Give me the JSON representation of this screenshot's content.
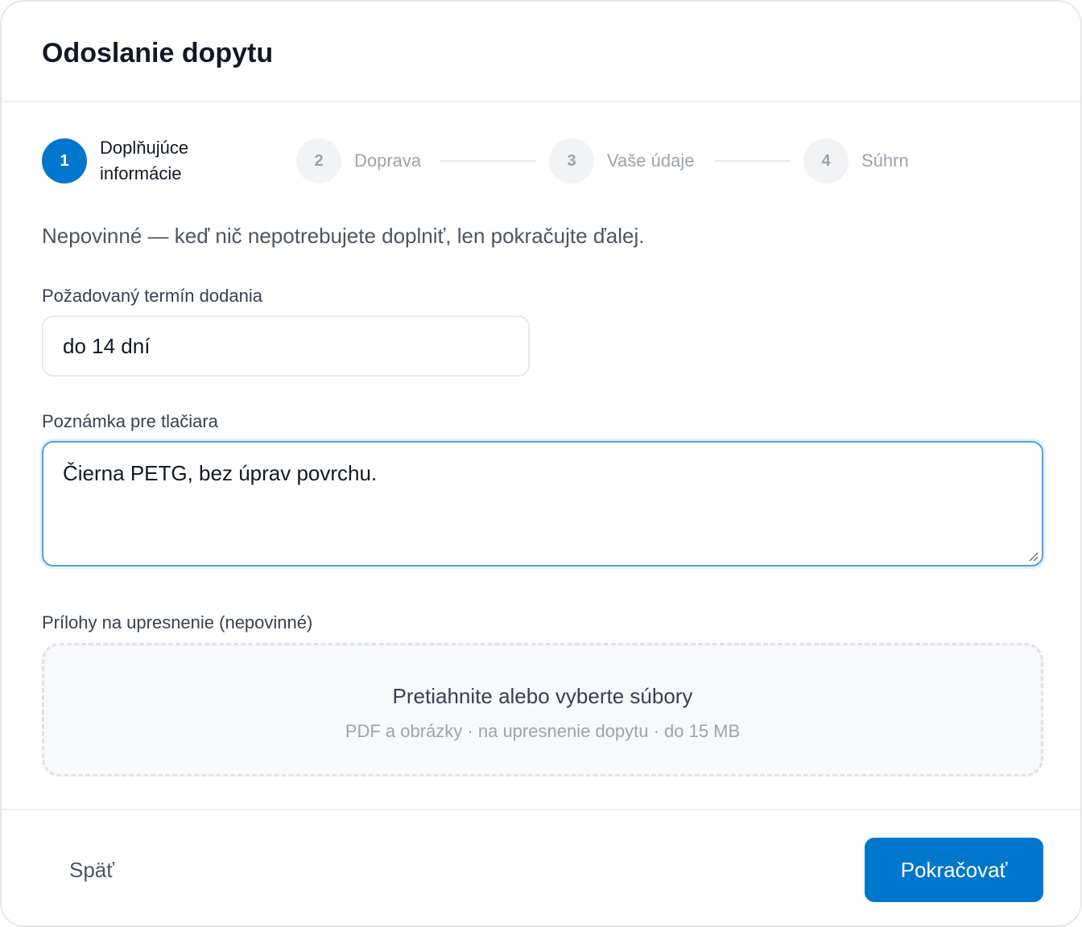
{
  "dialog": {
    "title": "Odoslanie dopytu"
  },
  "stepper": {
    "steps": [
      {
        "number": "1",
        "label": "Doplňujúce informácie",
        "state": "active"
      },
      {
        "number": "2",
        "label": "Doprava",
        "state": "inactive"
      },
      {
        "number": "3",
        "label": "Vaše údaje",
        "state": "inactive"
      },
      {
        "number": "4",
        "label": "Súhrn",
        "state": "inactive"
      }
    ]
  },
  "hint": "Nepovinné — keď nič nepotrebujete doplniť, len pokračujte ďalej.",
  "delivery": {
    "label": "Požadovaný termín dodania",
    "value": "do 14 dní"
  },
  "note": {
    "label": "Poznámka pre tlačiara",
    "value": "Čierna PETG, bez úprav povrchu."
  },
  "attachments": {
    "label": "Prílohy na upresnenie (nepovinné)",
    "dropzone_title": "Pretiahnite alebo vyberte súbory",
    "dropzone_subtitle": "PDF a obrázky · na upresnenie dopytu · do 15 MB"
  },
  "footer": {
    "back_label": "Späť",
    "next_label": "Pokračovať"
  },
  "colors": {
    "accent": "#0077cc",
    "focus_border": "#4aa3e8",
    "inactive_step_bg": "#f1f3f5"
  }
}
